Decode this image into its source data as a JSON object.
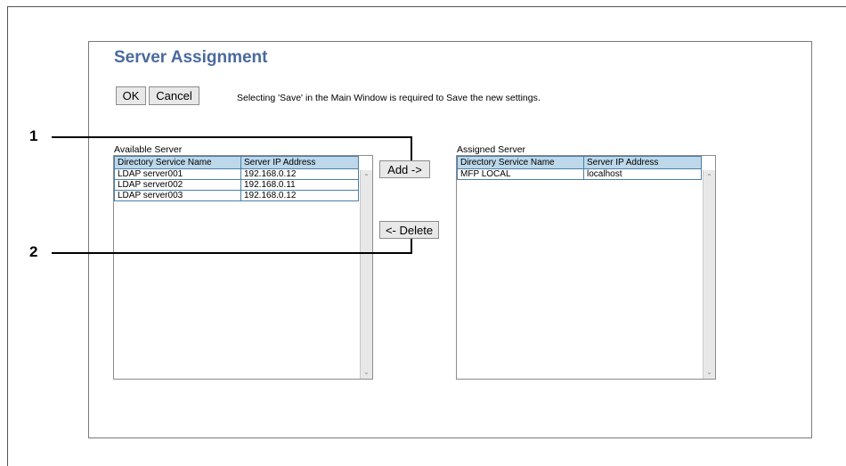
{
  "window": {
    "title": "Server Assignment",
    "ok_label": "OK",
    "cancel_label": "Cancel",
    "notice": "Selecting 'Save' in the Main Window is required to Save the new settings."
  },
  "available": {
    "label": "Available Server",
    "columns": [
      "Directory Service Name",
      "Server IP Address"
    ],
    "rows": [
      [
        "LDAP server001",
        "192.168.0.12"
      ],
      [
        "LDAP server002",
        "192.168.0.11"
      ],
      [
        "LDAP server003",
        "192.168.0.12"
      ]
    ]
  },
  "assigned": {
    "label": "Assigned Server",
    "columns": [
      "Directory Service Name",
      "Server IP Address"
    ],
    "rows": [
      [
        "MFP LOCAL",
        "localhost"
      ]
    ]
  },
  "actions": {
    "add_label": "Add ->",
    "delete_label": "<- Delete"
  },
  "callouts": [
    "1",
    "2"
  ],
  "icons": {
    "scroll_up": "chevron-up-icon",
    "scroll_down": "chevron-down-icon"
  }
}
